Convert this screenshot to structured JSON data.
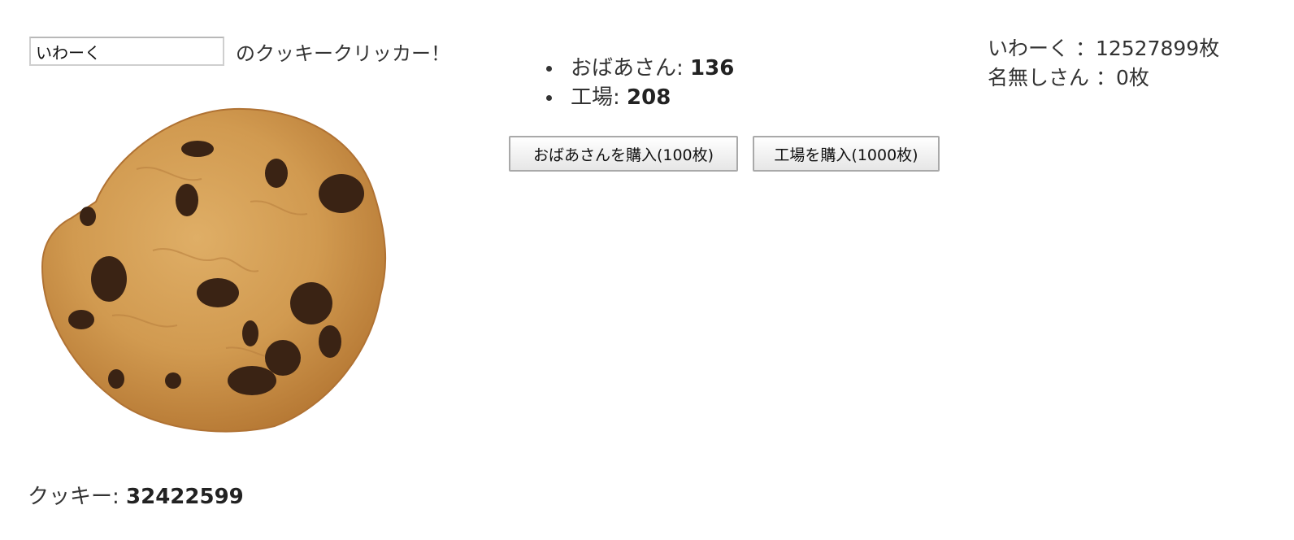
{
  "player": {
    "name_value": "いわーく",
    "title_suffix": "のクッキークリッカー！"
  },
  "cookie": {
    "icon": "chocolate-chip-cookie",
    "counter_label": "クッキー:",
    "counter_value": "32422599"
  },
  "buildings": [
    {
      "label": "おばあさん:",
      "count": "136"
    },
    {
      "label": "工場:",
      "count": "208"
    }
  ],
  "buy_buttons": {
    "grandma": "おばあさんを購入(100枚)",
    "factory": "工場を購入(1000枚)"
  },
  "ranking": [
    {
      "text": "いわーく ：12527899枚"
    },
    {
      "text": "名無しさん ：0枚"
    }
  ],
  "colors": {
    "text": "#333333",
    "cookie_dough": "#d39b4f",
    "chocolate_chip": "#3a2314"
  }
}
